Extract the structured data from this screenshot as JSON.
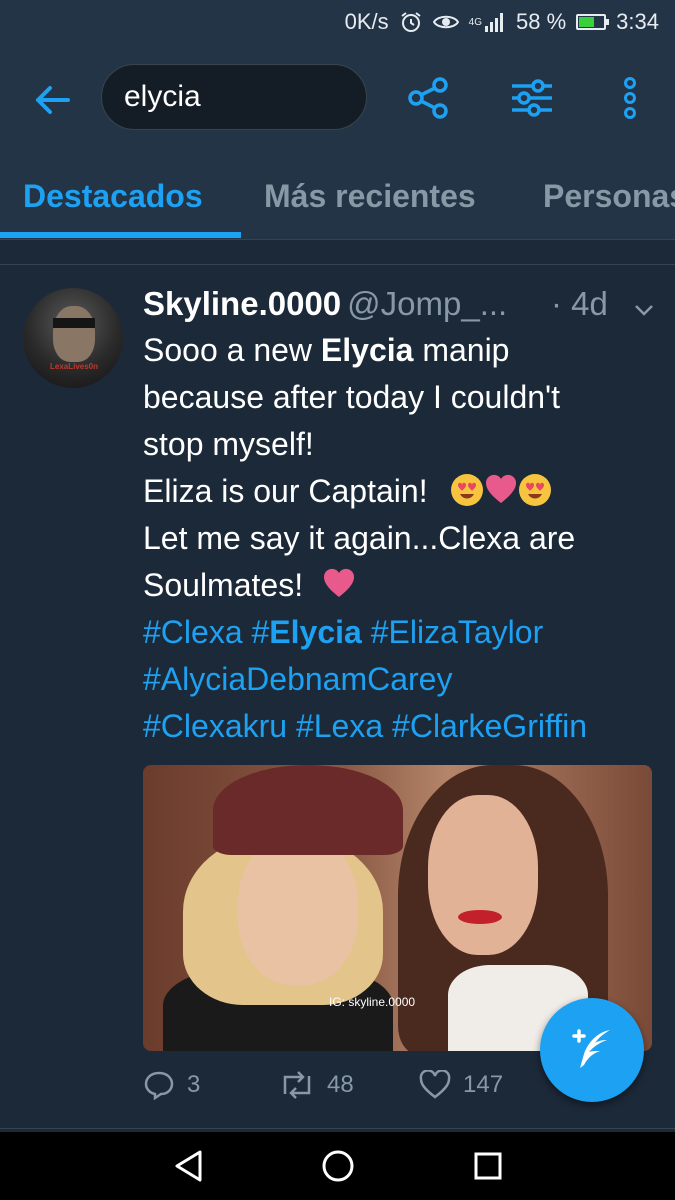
{
  "status_bar": {
    "net_speed": "0K/s",
    "alarm_icon": "alarm-icon",
    "eye_icon": "eye-comfort-icon",
    "network_type": "4G",
    "battery_percent": "58 %",
    "battery_level": 0.58,
    "time": "3:34"
  },
  "app_bar": {
    "search_value": "elycia",
    "back_icon": "back-arrow-icon",
    "share_icon": "share-icon",
    "filter_icon": "filter-sliders-icon",
    "more_icon": "more-vertical-icon"
  },
  "tabs": [
    {
      "label": "Destacados",
      "active": true
    },
    {
      "label": "Más recientes",
      "active": false
    },
    {
      "label": "Personas",
      "active": false
    }
  ],
  "tweet": {
    "display_name": "Skyline.0000",
    "handle": "@Jomp_...",
    "time": "· 4d",
    "avatar_watermark": "LexaLives0n",
    "text": {
      "l1_a": "Sooo a new ",
      "l1_b": "Elycia",
      "l1_c": " manip",
      "l2": "because after today I couldn't",
      "l3": "stop myself!",
      "l4": "Eliza is our Captain!",
      "l5": "Let me say it again...Clexa are",
      "l6": "Soulmates!",
      "l7_a": "#Clexa ",
      "l7_b": "#",
      "l7_c": "Elycia",
      "l7_d": " #ElizaTaylor",
      "l8": "#AlyciaDebnamCarey",
      "l9": "#Clexakru #Lexa #ClarkeGriffin"
    },
    "media_watermark": "IG: skyline.0000",
    "actions": {
      "reply_count": "3",
      "retweet_count": "48",
      "like_count": "147"
    }
  },
  "colors": {
    "background": "#1c2938",
    "bar": "#243447",
    "accent": "#1da1f2",
    "secondary_text": "#8899a6",
    "heart_emoji": "#e85a8b"
  },
  "fab": {
    "icon": "compose-tweet-icon"
  },
  "nav_bar": {
    "back": "nav-back-icon",
    "home": "nav-home-icon",
    "recents": "nav-recents-icon"
  }
}
